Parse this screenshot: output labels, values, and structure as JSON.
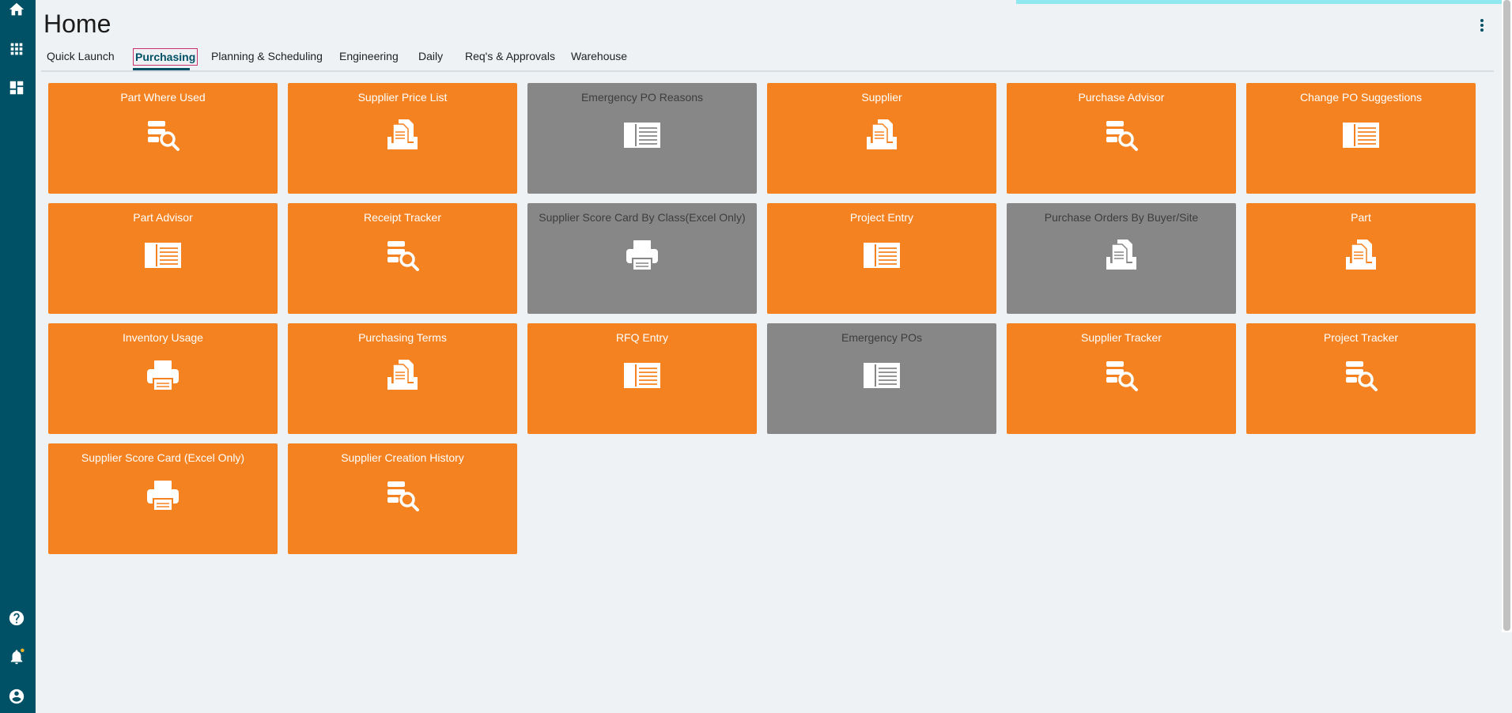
{
  "page": {
    "title": "Home"
  },
  "colors": {
    "sidebar": "#005165",
    "tile_active": "#f48220",
    "tile_inactive": "#878787",
    "accent": "#005165"
  },
  "sidebar": {
    "top_icons": [
      "home-icon",
      "apps-grid-icon",
      "dashboard-icon"
    ],
    "bottom_icons": [
      "help-icon",
      "notifications-icon",
      "user-account-icon"
    ]
  },
  "tabs": [
    {
      "label": "Quick Launch",
      "active": false
    },
    {
      "label": "Purchasing",
      "active": true
    },
    {
      "label": "Planning & Scheduling",
      "active": false
    },
    {
      "label": "Engineering",
      "active": false
    },
    {
      "label": "Daily",
      "active": false
    },
    {
      "label": "Req's & Approvals",
      "active": false
    },
    {
      "label": "Warehouse",
      "active": false
    }
  ],
  "tiles": [
    {
      "label": "Part Where Used",
      "icon": "search-list-icon",
      "state": "active"
    },
    {
      "label": "Supplier Price List",
      "icon": "documents-tray-icon",
      "state": "active"
    },
    {
      "label": "Emergency PO Reasons",
      "icon": "form-panel-icon",
      "state": "inactive"
    },
    {
      "label": "Supplier",
      "icon": "documents-tray-icon",
      "state": "active"
    },
    {
      "label": "Purchase Advisor",
      "icon": "search-list-icon",
      "state": "active"
    },
    {
      "label": "Change PO Suggestions",
      "icon": "form-panel-icon",
      "state": "active"
    },
    {
      "label": "Part Advisor",
      "icon": "form-panel-icon",
      "state": "active"
    },
    {
      "label": "Receipt Tracker",
      "icon": "search-list-icon",
      "state": "active"
    },
    {
      "label": "Supplier Score Card By Class(Excel Only)",
      "icon": "printer-icon",
      "state": "inactive"
    },
    {
      "label": "Project Entry",
      "icon": "form-panel-icon",
      "state": "active"
    },
    {
      "label": "Purchase Orders By Buyer/Site",
      "icon": "documents-tray-icon",
      "state": "inactive"
    },
    {
      "label": "Part",
      "icon": "documents-tray-icon",
      "state": "active"
    },
    {
      "label": "Inventory Usage",
      "icon": "printer-icon",
      "state": "active"
    },
    {
      "label": "Purchasing Terms",
      "icon": "documents-tray-icon",
      "state": "active"
    },
    {
      "label": "RFQ Entry",
      "icon": "form-panel-icon",
      "state": "active"
    },
    {
      "label": "Emergency POs",
      "icon": "form-panel-icon",
      "state": "inactive"
    },
    {
      "label": "Supplier Tracker",
      "icon": "search-list-icon",
      "state": "active"
    },
    {
      "label": "Project Tracker",
      "icon": "search-list-icon",
      "state": "active"
    },
    {
      "label": "Supplier Score Card (Excel Only)",
      "icon": "printer-icon",
      "state": "active"
    },
    {
      "label": "Supplier Creation History",
      "icon": "search-list-icon",
      "state": "active"
    }
  ]
}
